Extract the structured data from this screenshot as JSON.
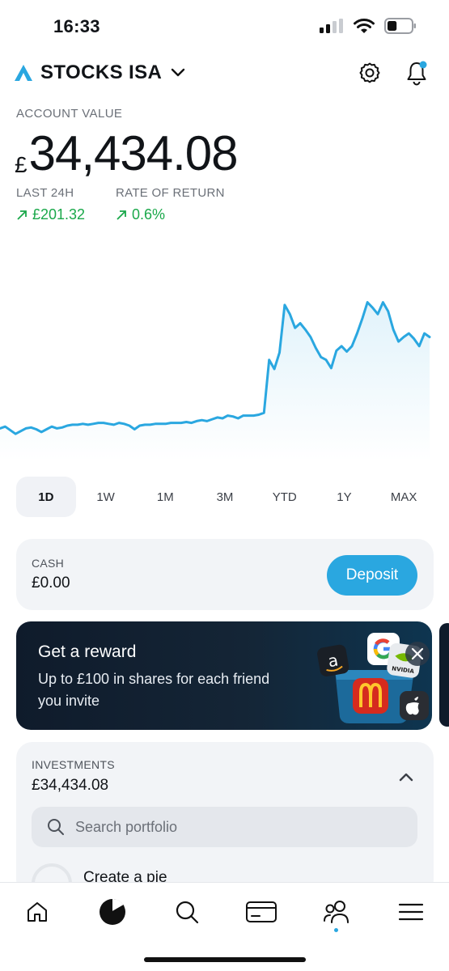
{
  "status_bar": {
    "time": "16:33",
    "battery_level": 0.4
  },
  "header": {
    "account_name": "STOCKS ISA"
  },
  "account": {
    "label": "ACCOUNT VALUE",
    "currency_symbol": "£",
    "value": "34,434.08",
    "metrics": [
      {
        "label": "LAST 24H",
        "value": "£201.32"
      },
      {
        "label": "RATE OF RETURN",
        "value": "0.6%"
      }
    ]
  },
  "colors": {
    "accent": "#2aa7e0",
    "gain": "#1aa84a",
    "promo_bg": "#0f1b2b"
  },
  "time_ranges": {
    "items": [
      "1D",
      "1W",
      "1M",
      "3M",
      "YTD",
      "1Y",
      "MAX"
    ],
    "selected": "1D"
  },
  "cash": {
    "label": "CASH",
    "value": "£0.00",
    "button": "Deposit"
  },
  "reward": {
    "title": "Get a reward",
    "text": "Up to £100 in shares for each friend you invite",
    "brand_tiles": [
      "amazon",
      "google",
      "nvidia",
      "mcdonalds",
      "apple"
    ],
    "nvidia_label": "NVIDIA"
  },
  "investments": {
    "label": "INVESTMENTS",
    "value": "£34,434.08",
    "search_placeholder": "Search portfolio",
    "create_pie": "Create a pie"
  },
  "tab_bar": {
    "items": [
      "home-icon",
      "portfolio-pie-icon",
      "search-icon",
      "card-icon",
      "people-icon",
      "menu-icon"
    ],
    "selected": "portfolio-pie-icon"
  },
  "chart_data": {
    "type": "area",
    "title": "",
    "xlabel": "",
    "ylabel": "",
    "grid": false,
    "line_color": "#2aa7e0",
    "values": [
      20,
      22,
      18,
      14,
      17,
      20,
      21,
      19,
      16,
      19,
      22,
      20,
      21,
      23,
      24,
      24,
      25,
      24,
      25,
      26,
      26,
      25,
      24,
      26,
      25,
      23,
      19,
      23,
      24,
      24,
      25,
      25,
      25,
      26,
      26,
      26,
      27,
      26,
      28,
      29,
      28,
      30,
      32,
      31,
      34,
      33,
      31,
      34,
      34,
      34,
      35,
      37,
      95,
      85,
      103,
      155,
      145,
      130,
      135,
      128,
      120,
      108,
      98,
      95,
      86,
      105,
      110,
      104,
      110,
      124,
      140,
      158,
      152,
      145,
      158,
      148,
      128,
      115,
      120,
      124,
      118,
      110,
      124,
      120
    ]
  }
}
